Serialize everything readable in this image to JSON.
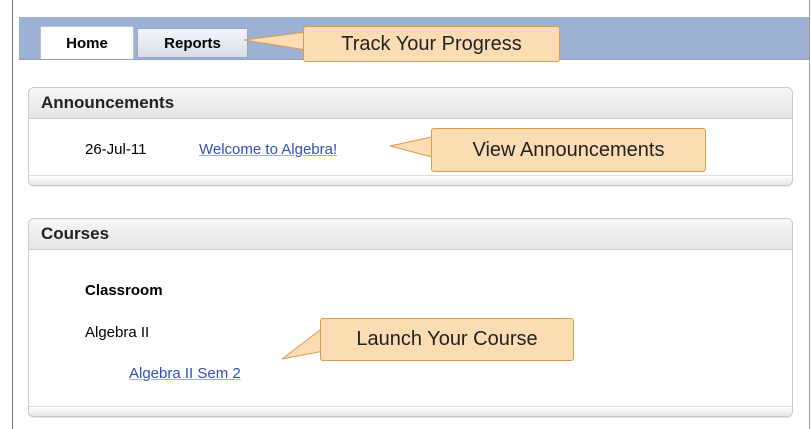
{
  "tabs": {
    "home_label": "Home",
    "reports_label": "Reports"
  },
  "announcements": {
    "title": "Announcements",
    "items": [
      {
        "date": "26-Jul-11",
        "title": "Welcome to Algebra!"
      }
    ]
  },
  "courses": {
    "title": "Courses",
    "group_label": "Classroom",
    "course_name": "Algebra II",
    "course_link": "Algebra II Sem 2"
  },
  "callouts": {
    "progress": "Track Your Progress",
    "announcements": "View Announcements",
    "course": "Launch Your Course"
  },
  "colors": {
    "tabbar": "#9cb1d4",
    "link": "#2f4fbe",
    "callout_fill": "#fcdcb3",
    "callout_border": "#d99b52"
  }
}
